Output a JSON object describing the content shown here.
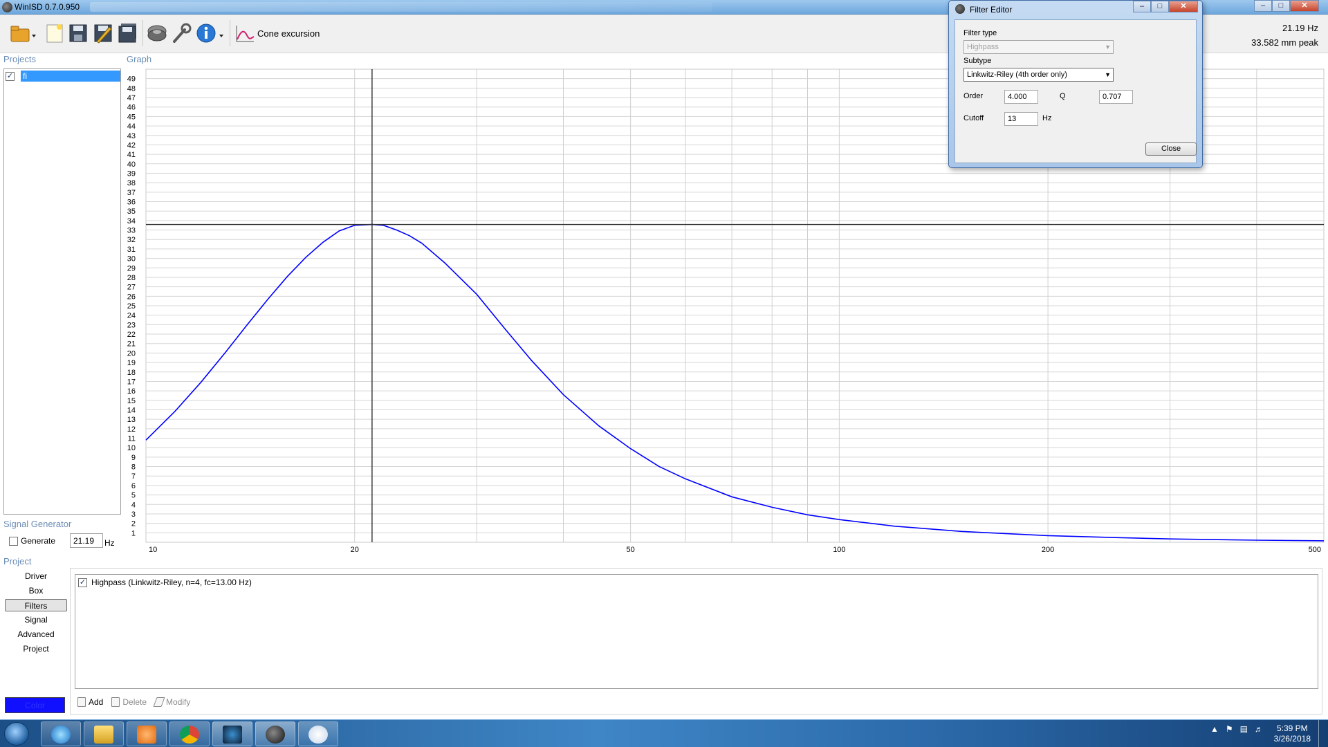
{
  "window": {
    "title": "WinISD 0.7.0.950"
  },
  "toolbar": {
    "items": [
      "open-icon",
      "new-project-icon",
      "save-icon",
      "save-edit-icon",
      "save-all-icon",
      "driver-icon",
      "wrench-icon",
      "info-icon"
    ],
    "graph_select_label": "Cone excursion"
  },
  "cursor_readout": {
    "frequency": "21.19 Hz",
    "value": "33.582 mm peak"
  },
  "panels": {
    "projects": "Projects",
    "graph": "Graph",
    "signal_generator": "Signal Generator",
    "project": "Project"
  },
  "projects": [
    {
      "name": "fi",
      "checked": true
    }
  ],
  "signal_generator": {
    "generate_label": "Generate",
    "frequency": "21.19",
    "unit": "Hz"
  },
  "project_nav": [
    {
      "label": "Driver",
      "active": false
    },
    {
      "label": "Box",
      "active": false
    },
    {
      "label": "Filters",
      "active": true
    },
    {
      "label": "Signal",
      "active": false
    },
    {
      "label": "Advanced",
      "active": false
    },
    {
      "label": "Project",
      "active": false
    }
  ],
  "color_button": {
    "label": "Color",
    "color": "#1010ff"
  },
  "filters": [
    {
      "label": "Highpass (Linkwitz-Riley, n=4, fc=13.00 Hz)",
      "checked": true
    }
  ],
  "filter_actions": {
    "add": "Add",
    "delete": "Delete",
    "modify": "Modify"
  },
  "filter_editor": {
    "title": "Filter Editor",
    "filter_type_label": "Filter type",
    "filter_type_value": "Highpass",
    "subtype_label": "Subtype",
    "subtype_value": "Linkwitz-Riley (4th order only)",
    "order_label": "Order",
    "order_value": "4.000",
    "q_label": "Q",
    "q_value": "0.707",
    "cutoff_label": "Cutoff",
    "cutoff_value": "13",
    "cutoff_unit": "Hz",
    "close_label": "Close"
  },
  "chart_data": {
    "type": "line",
    "title": "",
    "xlabel": "",
    "ylabel": "",
    "x_scale": "log",
    "xlim": [
      10,
      500
    ],
    "ylim": [
      0,
      50
    ],
    "grid": true,
    "x_tick_labels": [
      "10",
      "20",
      "50",
      "100",
      "200",
      "500"
    ],
    "x_tick_values": [
      10,
      20,
      50,
      100,
      200,
      500
    ],
    "y_tick_labels": [
      "1",
      "2",
      "3",
      "4",
      "5",
      "6",
      "7",
      "8",
      "9",
      "10",
      "11",
      "12",
      "13",
      "14",
      "15",
      "16",
      "17",
      "18",
      "19",
      "20",
      "21",
      "22",
      "23",
      "24",
      "25",
      "26",
      "27",
      "28",
      "29",
      "30",
      "31",
      "32",
      "33",
      "34",
      "35",
      "36",
      "37",
      "38",
      "39",
      "40",
      "41",
      "42",
      "43",
      "44",
      "45",
      "46",
      "47",
      "48",
      "49"
    ],
    "cursor": {
      "x": 21.19,
      "y": 33.582
    },
    "series": [
      {
        "color": "#0000ff",
        "x": [
          10,
          11,
          12,
          13,
          14,
          15,
          16,
          17,
          18,
          19,
          20,
          21.19,
          22,
          23,
          24,
          25,
          27,
          30,
          33,
          36,
          40,
          45,
          50,
          55,
          60,
          70,
          80,
          90,
          100,
          120,
          150,
          200,
          250,
          300,
          400,
          500
        ],
        "y": [
          10.8,
          13.8,
          16.9,
          20.0,
          23.0,
          25.7,
          28.1,
          30.1,
          31.7,
          32.9,
          33.5,
          33.58,
          33.5,
          33.0,
          32.4,
          31.6,
          29.5,
          26.2,
          22.5,
          19.2,
          15.6,
          12.3,
          9.9,
          8.0,
          6.7,
          4.8,
          3.7,
          2.9,
          2.4,
          1.7,
          1.15,
          0.7,
          0.5,
          0.35,
          0.22,
          0.15
        ]
      }
    ]
  }
}
